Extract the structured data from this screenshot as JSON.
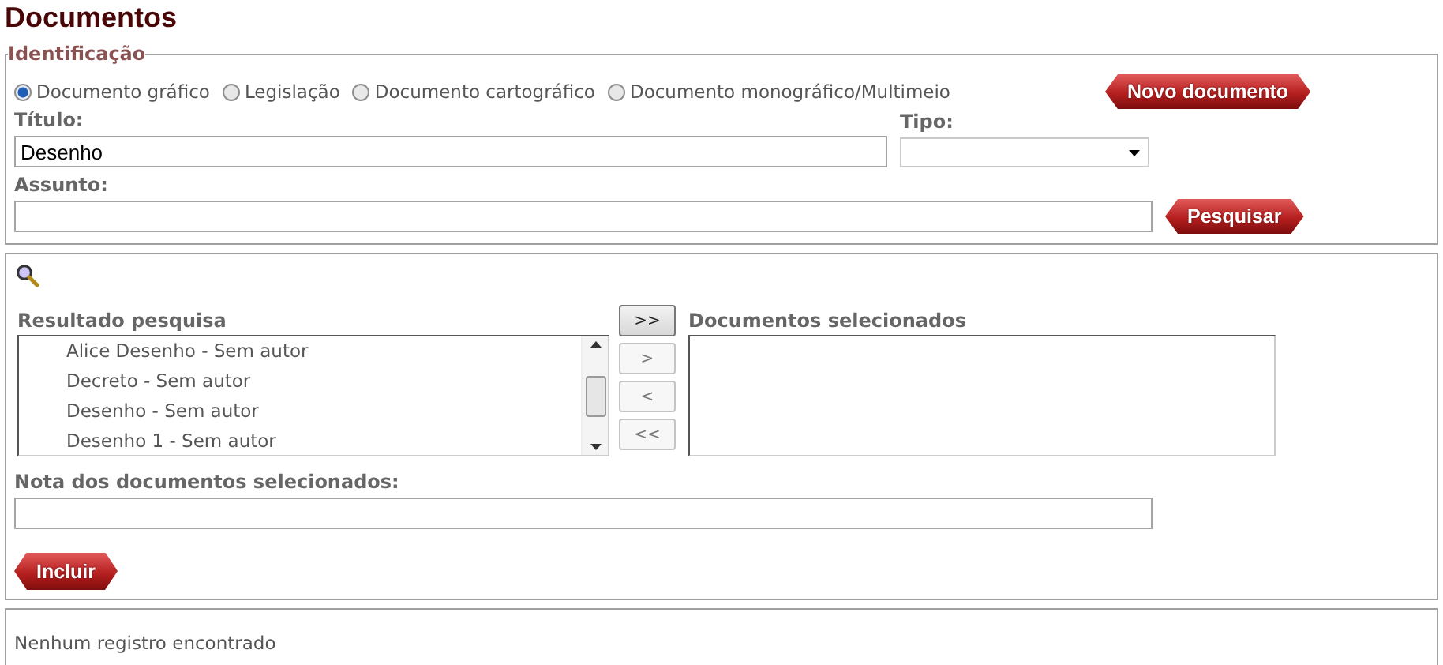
{
  "page_title": "Documentos",
  "identification": {
    "legend": "Identificação",
    "document_types": [
      {
        "label": "Documento gráfico",
        "selected": true
      },
      {
        "label": "Legislação",
        "selected": false
      },
      {
        "label": "Documento cartográfico",
        "selected": false
      },
      {
        "label": "Documento monográfico/Multimeio",
        "selected": false
      }
    ],
    "new_button": "Novo documento",
    "title_label": "Título:",
    "title_value": "Desenho",
    "type_label": "Tipo:",
    "subject_label": "Assunto:",
    "search_button": "Pesquisar"
  },
  "selection": {
    "results_label": "Resultado pesquisa",
    "results": [
      "Alice Desenho - Sem autor",
      "Decreto - Sem autor",
      "Desenho - Sem autor",
      "Desenho 1 - Sem autor"
    ],
    "transfer_buttons": [
      {
        "label": ">>",
        "active": true
      },
      {
        "label": ">",
        "active": false
      },
      {
        "label": "<",
        "active": false
      },
      {
        "label": "<<",
        "active": false
      }
    ],
    "selected_label": "Documentos selecionados",
    "note_label": "Nota dos documentos selecionados:",
    "include_button": "Incluir"
  },
  "status_message": "Nenhum registro encontrado"
}
